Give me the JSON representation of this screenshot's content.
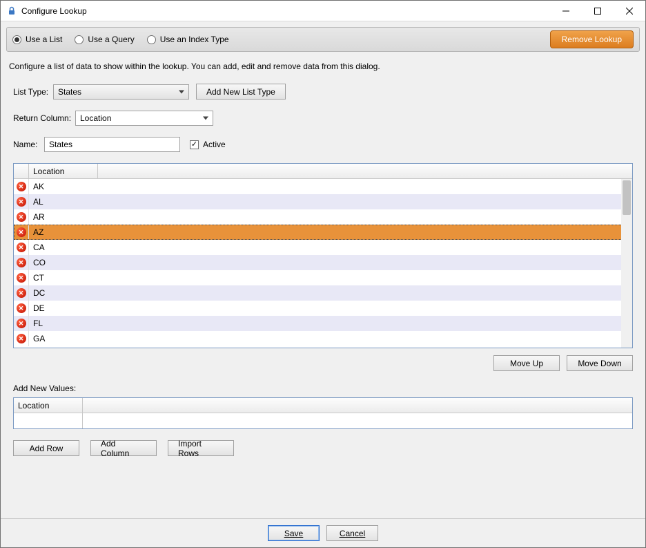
{
  "window": {
    "title": "Configure Lookup"
  },
  "modebar": {
    "options": [
      {
        "label": "Use a List",
        "selected": true
      },
      {
        "label": "Use a Query",
        "selected": false
      },
      {
        "label": "Use an Index Type",
        "selected": false
      }
    ],
    "remove_label": "Remove Lookup"
  },
  "description": "Configure a list of data to show within the lookup. You can add, edit and remove data from this dialog.",
  "form": {
    "list_type_label": "List Type:",
    "list_type_value": "States",
    "add_list_type_label": "Add New List Type",
    "return_column_label": "Return Column:",
    "return_column_value": "Location",
    "name_label": "Name:",
    "name_value": "States",
    "active_label": "Active",
    "active_checked": true
  },
  "grid": {
    "column_header": "Location",
    "rows": [
      "AK",
      "AL",
      "AR",
      "AZ",
      "CA",
      "CO",
      "CT",
      "DC",
      "DE",
      "FL",
      "GA"
    ],
    "selected_index": 3
  },
  "move": {
    "up_label": "Move Up",
    "down_label": "Move Down"
  },
  "add_new": {
    "section_label": "Add New Values:",
    "column_header": "Location"
  },
  "row_buttons": {
    "add_row": "Add Row",
    "add_column": "Add Column",
    "import_rows": "Import Rows"
  },
  "footer": {
    "save": "Save",
    "cancel": "Cancel"
  }
}
